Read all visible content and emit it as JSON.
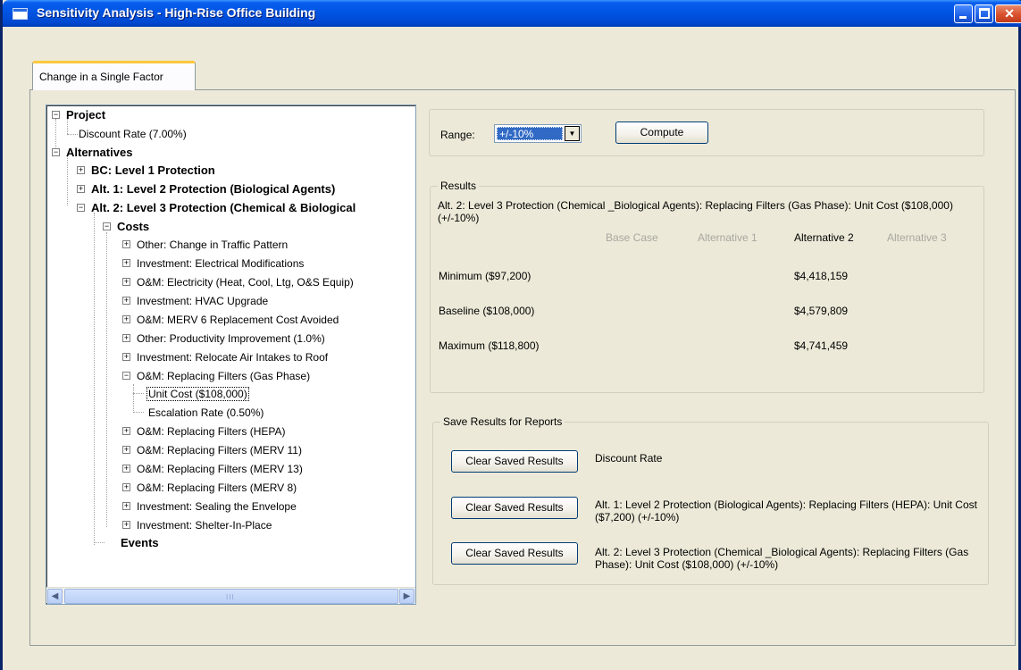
{
  "window": {
    "title": "Sensitivity Analysis - High-Rise Office Building"
  },
  "tabs": [
    {
      "label": "Change in a Single Factor",
      "selected": true
    }
  ],
  "tree": {
    "project_label": "Project",
    "discount_rate": "Discount Rate (7.00%)",
    "alternatives_label": "Alternatives",
    "alt_bc": "BC: Level 1 Protection",
    "alt_1": "Alt. 1: Level 2 Protection (Biological Agents)",
    "alt_2": "Alt. 2: Level 3 Protection (Chemical & Biological",
    "costs_label": "Costs",
    "cost_items": [
      "Other: Change in Traffic Pattern",
      "Investment: Electrical Modifications",
      "O&M: Electricity (Heat, Cool, Ltg, O&S Equip)",
      "Investment: HVAC Upgrade",
      "O&M: MERV 6 Replacement Cost Avoided",
      "Other: Productivity Improvement (1.0%)",
      "Investment: Relocate Air Intakes to Roof",
      "O&M: Replacing Filters (Gas Phase)"
    ],
    "gas_phase_children": [
      "Unit Cost ($108,000)",
      "Escalation Rate (0.50%)"
    ],
    "cost_items_after": [
      "O&M: Replacing Filters (HEPA)",
      "O&M: Replacing Filters (MERV 11)",
      "O&M: Replacing Filters (MERV 13)",
      "O&M: Replacing Filters (MERV 8)",
      "Investment: Sealing the Envelope",
      "Investment: Shelter-In-Place"
    ],
    "events_label": "Events",
    "scroll_grip": "III"
  },
  "range": {
    "label": "Range:",
    "value": "+/-10%"
  },
  "compute_label": "Compute",
  "results": {
    "group_title": "Results",
    "description": "Alt. 2: Level 3 Protection (Chemical _Biological Agents): Replacing Filters (Gas Phase): Unit Cost ($108,000) (+/-10%)",
    "columns": [
      "Base Case",
      "Alternative 1",
      "Alternative 2",
      "Alternative 3"
    ],
    "rows": [
      {
        "label": "Minimum  ($97,200)",
        "alt2": "$4,418,159"
      },
      {
        "label": "Baseline  ($108,000)",
        "alt2": "$4,579,809"
      },
      {
        "label": "Maximum  ($118,800)",
        "alt2": "$4,741,459"
      }
    ]
  },
  "saved": {
    "group_title": "Save Results for Reports",
    "button_label": "Clear Saved Results",
    "entries": [
      "Discount Rate",
      "Alt. 1: Level 2 Protection (Biological Agents): Replacing Filters (HEPA): Unit Cost ($7,200) (+/-10%)",
      "Alt. 2: Level 3 Protection (Chemical _Biological Agents): Replacing Filters (Gas Phase): Unit Cost ($108,000) (+/-10%)"
    ]
  }
}
